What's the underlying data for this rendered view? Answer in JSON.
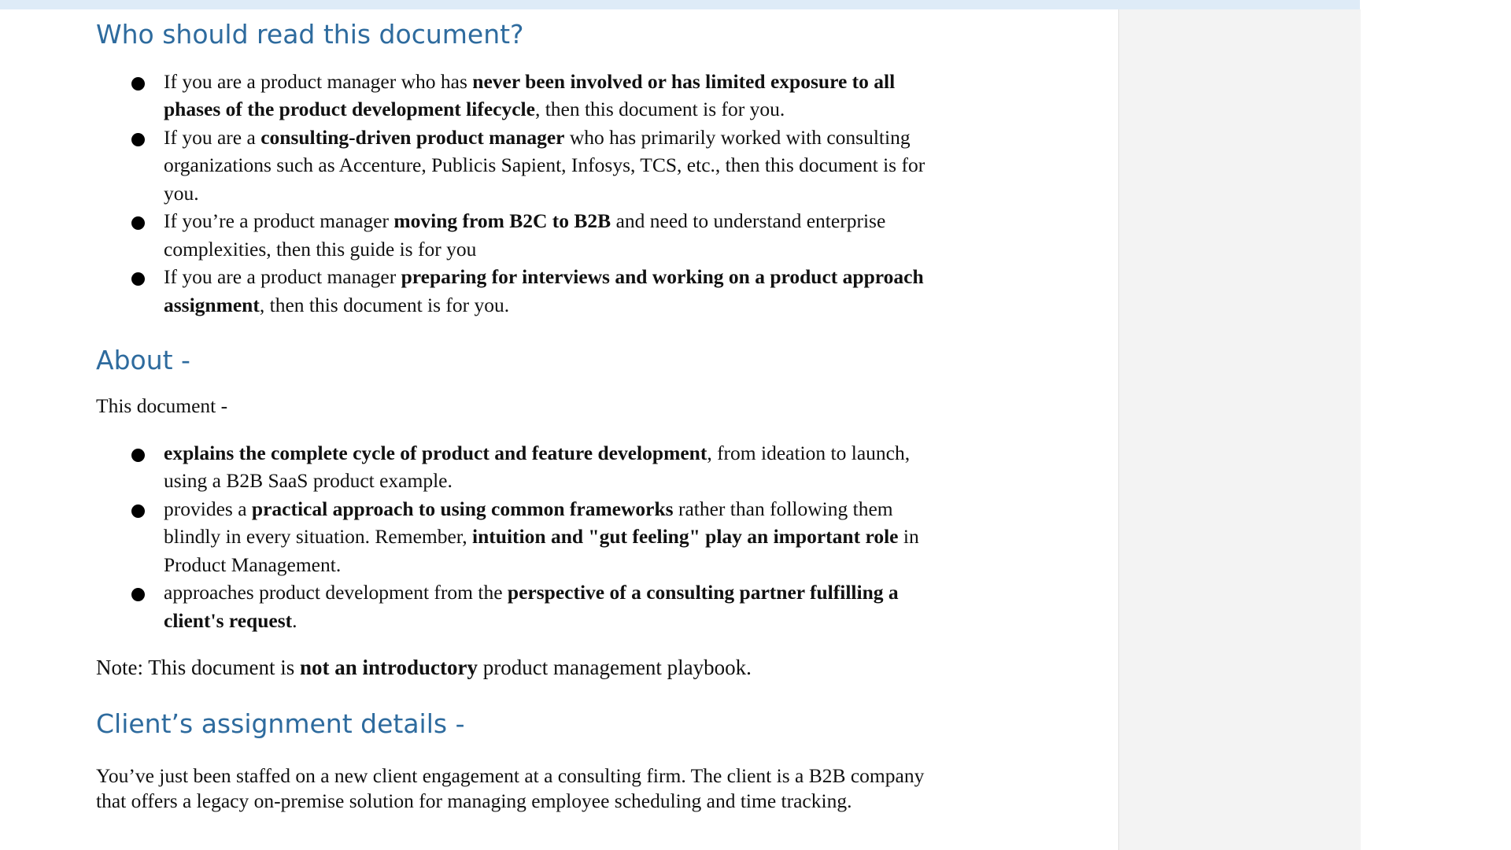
{
  "section_who": {
    "heading": "Who should read this document?",
    "bullets": [
      {
        "t1": "If you are a product manager who has ",
        "b1": "never been involved or has limited exposure to all phases of the product development lifecycle",
        "t2": ", then this document is for you."
      },
      {
        "t1": "If you are a ",
        "b1": "consulting-driven product manager",
        "t2": " who has primarily worked with consulting organizations such as Accenture, Publicis Sapient, Infosys, TCS, etc., then this document is for you."
      },
      {
        "t1": "If you’re a product manager ",
        "b1": "moving from B2C to B2B",
        "t2": " and need to understand enterprise complexities, then this guide is for you"
      },
      {
        "t1": "If you are a product manager ",
        "b1": "preparing for interviews and working on a product approach assignment",
        "t2": ", then this document is for you."
      }
    ]
  },
  "section_about": {
    "heading": "About -",
    "intro": "This document -",
    "bullets": [
      {
        "b1": "explains the complete cycle of product and feature development",
        "t1": ", from ideation to launch, using a B2B SaaS product example."
      },
      {
        "t1": "provides a ",
        "b1": "practical approach to using common frameworks",
        "t2": " rather than following them blindly in every situation. Remember, ",
        "b2": "intuition and \"gut feeling\" play an important role",
        "t3": " in Product Management."
      },
      {
        "t1": "approaches product development from the ",
        "b1": "perspective of a consulting partner fulfilling a client's request",
        "t2": "."
      }
    ],
    "note": {
      "t1": "Note: This document is ",
      "b1": "not an introductory",
      "t2": " product management playbook."
    }
  },
  "section_client": {
    "heading": "Client’s assignment details -",
    "paragraph": "You’ve just been staffed on a new client engagement at a consulting firm. The client is a B2B company that offers a legacy on-premise solution for managing employee scheduling and time tracking."
  }
}
